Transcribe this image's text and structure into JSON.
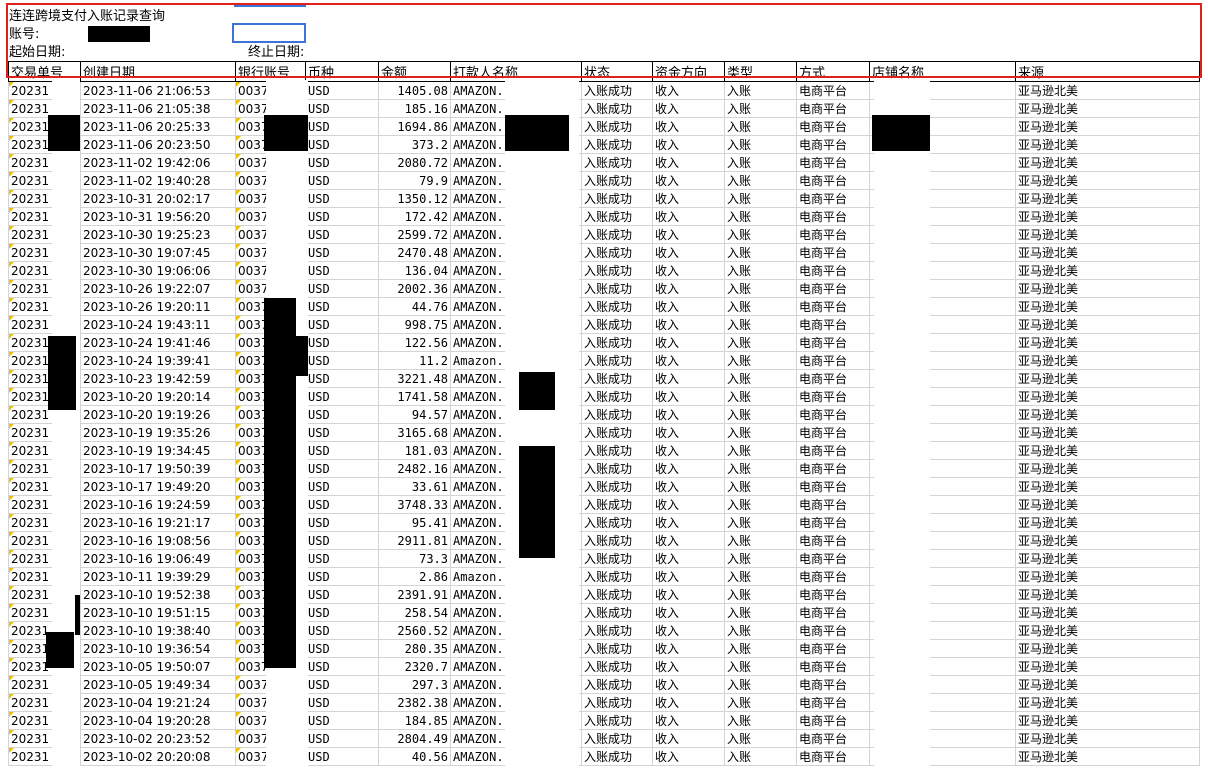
{
  "header": {
    "title": "连连跨境支付入账记录查询",
    "account_label": "账号:",
    "start_label": "起始日期:",
    "end_label": "终止日期:"
  },
  "columns": [
    "交易单号",
    "创建日期",
    "银行账号",
    "币种",
    "金额",
    "打款人名称",
    "状态",
    "资金方向",
    "类型",
    "方式",
    "店铺名称",
    "来源"
  ],
  "rows": [
    {
      "id": "20231",
      "date": "2023-11-06 21:06:53",
      "bank": "0037",
      "cur": "USD",
      "amount": "1405.08",
      "payer": "AMAZON.",
      "status": "入账成功",
      "dir": "收入",
      "type": "入账",
      "method": "电商平台",
      "source": "亚马逊北美"
    },
    {
      "id": "20231",
      "date": "2023-11-06 21:05:38",
      "bank": "0037",
      "cur": "USD",
      "amount": "185.16",
      "payer": "AMAZON.",
      "status": "入账成功",
      "dir": "收入",
      "type": "入账",
      "method": "电商平台",
      "source": "亚马逊北美"
    },
    {
      "id": "20231",
      "date": "2023-11-06 20:25:33",
      "bank": "0037",
      "cur": "USD",
      "amount": "1694.86",
      "payer": "AMAZON.",
      "status": "入账成功",
      "dir": "收入",
      "type": "入账",
      "method": "电商平台",
      "source": "亚马逊北美"
    },
    {
      "id": "20231",
      "date": "2023-11-06 20:23:50",
      "bank": "0037",
      "cur": "USD",
      "amount": "373.2",
      "payer": "AMAZON.",
      "status": "入账成功",
      "dir": "收入",
      "type": "入账",
      "method": "电商平台",
      "source": "亚马逊北美"
    },
    {
      "id": "20231",
      "date": "2023-11-02 19:42:06",
      "bank": "0037",
      "cur": "USD",
      "amount": "2080.72",
      "payer": "AMAZON.",
      "status": "入账成功",
      "dir": "收入",
      "type": "入账",
      "method": "电商平台",
      "source": "亚马逊北美"
    },
    {
      "id": "20231",
      "date": "2023-11-02 19:40:28",
      "bank": "0037",
      "cur": "USD",
      "amount": "79.9",
      "payer": "AMAZON.",
      "status": "入账成功",
      "dir": "收入",
      "type": "入账",
      "method": "电商平台",
      "source": "亚马逊北美"
    },
    {
      "id": "20231",
      "date": "2023-10-31 20:02:17",
      "bank": "0037",
      "cur": "USD",
      "amount": "1350.12",
      "payer": "AMAZON.",
      "status": "入账成功",
      "dir": "收入",
      "type": "入账",
      "method": "电商平台",
      "source": "亚马逊北美"
    },
    {
      "id": "20231",
      "date": "2023-10-31 19:56:20",
      "bank": "0037",
      "cur": "USD",
      "amount": "172.42",
      "payer": "AMAZON.",
      "status": "入账成功",
      "dir": "收入",
      "type": "入账",
      "method": "电商平台",
      "source": "亚马逊北美"
    },
    {
      "id": "20231",
      "date": "2023-10-30 19:25:23",
      "bank": "0037",
      "cur": "USD",
      "amount": "2599.72",
      "payer": "AMAZON.",
      "status": "入账成功",
      "dir": "收入",
      "type": "入账",
      "method": "电商平台",
      "source": "亚马逊北美"
    },
    {
      "id": "20231",
      "date": "2023-10-30 19:07:45",
      "bank": "0037",
      "cur": "USD",
      "amount": "2470.48",
      "payer": "AMAZON.",
      "status": "入账成功",
      "dir": "收入",
      "type": "入账",
      "method": "电商平台",
      "source": "亚马逊北美"
    },
    {
      "id": "20231",
      "date": "2023-10-30 19:06:06",
      "bank": "0037",
      "cur": "USD",
      "amount": "136.04",
      "payer": "AMAZON.",
      "status": "入账成功",
      "dir": "收入",
      "type": "入账",
      "method": "电商平台",
      "source": "亚马逊北美"
    },
    {
      "id": "20231",
      "date": "2023-10-26 19:22:07",
      "bank": "0037",
      "cur": "USD",
      "amount": "2002.36",
      "payer": "AMAZON.",
      "status": "入账成功",
      "dir": "收入",
      "type": "入账",
      "method": "电商平台",
      "source": "亚马逊北美"
    },
    {
      "id": "20231",
      "date": "2023-10-26 19:20:11",
      "bank": "0037",
      "cur": "USD",
      "amount": "44.76",
      "payer": "AMAZON.",
      "status": "入账成功",
      "dir": "收入",
      "type": "入账",
      "method": "电商平台",
      "source": "亚马逊北美"
    },
    {
      "id": "20231",
      "date": "2023-10-24 19:43:11",
      "bank": "0037",
      "cur": "USD",
      "amount": "998.75",
      "payer": "AMAZON.",
      "status": "入账成功",
      "dir": "收入",
      "type": "入账",
      "method": "电商平台",
      "source": "亚马逊北美"
    },
    {
      "id": "20231",
      "date": "2023-10-24 19:41:46",
      "bank": "0037",
      "cur": "USD",
      "amount": "122.56",
      "payer": "AMAZON.",
      "status": "入账成功",
      "dir": "收入",
      "type": "入账",
      "method": "电商平台",
      "source": "亚马逊北美"
    },
    {
      "id": "20231",
      "date": "2023-10-24 19:39:41",
      "bank": "0037",
      "cur": "USD",
      "amount": "11.2",
      "payer": "Amazon.",
      "status": "入账成功",
      "dir": "收入",
      "type": "入账",
      "method": "电商平台",
      "source": "亚马逊北美"
    },
    {
      "id": "20231",
      "date": "2023-10-23 19:42:59",
      "bank": "0037",
      "cur": "USD",
      "amount": "3221.48",
      "payer": "AMAZON.",
      "status": "入账成功",
      "dir": "收入",
      "type": "入账",
      "method": "电商平台",
      "source": "亚马逊北美"
    },
    {
      "id": "20231",
      "date": "2023-10-20 19:20:14",
      "bank": "0037",
      "cur": "USD",
      "amount": "1741.58",
      "payer": "AMAZON.",
      "status": "入账成功",
      "dir": "收入",
      "type": "入账",
      "method": "电商平台",
      "source": "亚马逊北美"
    },
    {
      "id": "20231",
      "date": "2023-10-20 19:19:26",
      "bank": "0037",
      "cur": "USD",
      "amount": "94.57",
      "payer": "AMAZON.",
      "status": "入账成功",
      "dir": "收入",
      "type": "入账",
      "method": "电商平台",
      "source": "亚马逊北美"
    },
    {
      "id": "20231",
      "date": "2023-10-19 19:35:26",
      "bank": "0037",
      "cur": "USD",
      "amount": "3165.68",
      "payer": "AMAZON.",
      "status": "入账成功",
      "dir": "收入",
      "type": "入账",
      "method": "电商平台",
      "source": "亚马逊北美"
    },
    {
      "id": "20231",
      "date": "2023-10-19 19:34:45",
      "bank": "0037",
      "cur": "USD",
      "amount": "181.03",
      "payer": "AMAZON.",
      "status": "入账成功",
      "dir": "收入",
      "type": "入账",
      "method": "电商平台",
      "source": "亚马逊北美"
    },
    {
      "id": "20231",
      "date": "2023-10-17 19:50:39",
      "bank": "0037",
      "cur": "USD",
      "amount": "2482.16",
      "payer": "AMAZON.",
      "status": "入账成功",
      "dir": "收入",
      "type": "入账",
      "method": "电商平台",
      "source": "亚马逊北美"
    },
    {
      "id": "20231",
      "date": "2023-10-17 19:49:20",
      "bank": "0037",
      "cur": "USD",
      "amount": "33.61",
      "payer": "AMAZON.",
      "status": "入账成功",
      "dir": "收入",
      "type": "入账",
      "method": "电商平台",
      "source": "亚马逊北美"
    },
    {
      "id": "20231",
      "date": "2023-10-16 19:24:59",
      "bank": "0037",
      "cur": "USD",
      "amount": "3748.33",
      "payer": "AMAZON.",
      "status": "入账成功",
      "dir": "收入",
      "type": "入账",
      "method": "电商平台",
      "source": "亚马逊北美"
    },
    {
      "id": "20231",
      "date": "2023-10-16 19:21:17",
      "bank": "0037",
      "cur": "USD",
      "amount": "95.41",
      "payer": "AMAZON.",
      "status": "入账成功",
      "dir": "收入",
      "type": "入账",
      "method": "电商平台",
      "source": "亚马逊北美"
    },
    {
      "id": "20231",
      "date": "2023-10-16 19:08:56",
      "bank": "0037",
      "cur": "USD",
      "amount": "2911.81",
      "payer": "AMAZON.",
      "status": "入账成功",
      "dir": "收入",
      "type": "入账",
      "method": "电商平台",
      "source": "亚马逊北美"
    },
    {
      "id": "20231",
      "date": "2023-10-16 19:06:49",
      "bank": "0037",
      "cur": "USD",
      "amount": "73.3",
      "payer": "AMAZON.",
      "status": "入账成功",
      "dir": "收入",
      "type": "入账",
      "method": "电商平台",
      "source": "亚马逊北美"
    },
    {
      "id": "20231",
      "date": "2023-10-11 19:39:29",
      "bank": "0037",
      "cur": "USD",
      "amount": "2.86",
      "payer": "Amazon.",
      "status": "入账成功",
      "dir": "收入",
      "type": "入账",
      "method": "电商平台",
      "source": "亚马逊北美"
    },
    {
      "id": "20231",
      "date": "2023-10-10 19:52:38",
      "bank": "0037",
      "cur": "USD",
      "amount": "2391.91",
      "payer": "AMAZON.",
      "status": "入账成功",
      "dir": "收入",
      "type": "入账",
      "method": "电商平台",
      "source": "亚马逊北美"
    },
    {
      "id": "20231",
      "date": "2023-10-10 19:51:15",
      "bank": "0037",
      "cur": "USD",
      "amount": "258.54",
      "payer": "AMAZON.",
      "status": "入账成功",
      "dir": "收入",
      "type": "入账",
      "method": "电商平台",
      "source": "亚马逊北美"
    },
    {
      "id": "20231",
      "date": "2023-10-10 19:38:40",
      "bank": "0037",
      "cur": "USD",
      "amount": "2560.52",
      "payer": "AMAZON.",
      "status": "入账成功",
      "dir": "收入",
      "type": "入账",
      "method": "电商平台",
      "source": "亚马逊北美"
    },
    {
      "id": "20231",
      "date": "2023-10-10 19:36:54",
      "bank": "0037",
      "cur": "USD",
      "amount": "280.35",
      "payer": "AMAZON.",
      "status": "入账成功",
      "dir": "收入",
      "type": "入账",
      "method": "电商平台",
      "source": "亚马逊北美"
    },
    {
      "id": "20231",
      "date": "2023-10-05 19:50:07",
      "bank": "0037",
      "cur": "USD",
      "amount": "2320.7",
      "payer": "AMAZON.",
      "status": "入账成功",
      "dir": "收入",
      "type": "入账",
      "method": "电商平台",
      "source": "亚马逊北美"
    },
    {
      "id": "20231",
      "date": "2023-10-05 19:49:34",
      "bank": "0037",
      "cur": "USD",
      "amount": "297.3",
      "payer": "AMAZON.",
      "status": "入账成功",
      "dir": "收入",
      "type": "入账",
      "method": "电商平台",
      "source": "亚马逊北美"
    },
    {
      "id": "20231",
      "date": "2023-10-04 19:21:24",
      "bank": "0037",
      "cur": "USD",
      "amount": "2382.38",
      "payer": "AMAZON.",
      "status": "入账成功",
      "dir": "收入",
      "type": "入账",
      "method": "电商平台",
      "source": "亚马逊北美"
    },
    {
      "id": "20231",
      "date": "2023-10-04 19:20:28",
      "bank": "0037",
      "cur": "USD",
      "amount": "184.85",
      "payer": "AMAZON.",
      "status": "入账成功",
      "dir": "收入",
      "type": "入账",
      "method": "电商平台",
      "source": "亚马逊北美"
    },
    {
      "id": "20231",
      "date": "2023-10-02 20:23:52",
      "bank": "0037",
      "cur": "USD",
      "amount": "2804.49",
      "payer": "AMAZON.",
      "status": "入账成功",
      "dir": "收入",
      "type": "入账",
      "method": "电商平台",
      "source": "亚马逊北美"
    },
    {
      "id": "20231",
      "date": "2023-10-02 20:20:08",
      "bank": "0037",
      "cur": "USD",
      "amount": "40.56",
      "payer": "AMAZON.",
      "status": "入账成功",
      "dir": "收入",
      "type": "入账",
      "method": "电商平台",
      "source": "亚马逊北美"
    }
  ]
}
